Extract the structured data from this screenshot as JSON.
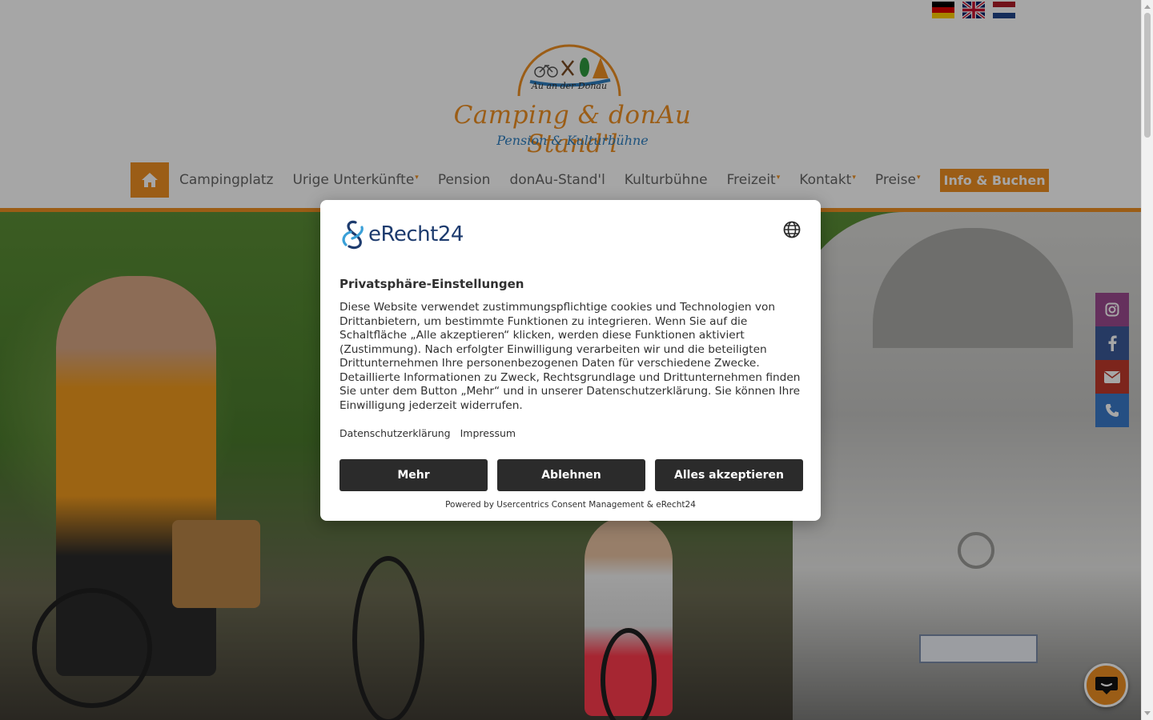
{
  "header": {
    "languages": [
      {
        "name": "de-flag-icon"
      },
      {
        "name": "gb-flag-icon"
      },
      {
        "name": "nl-flag-icon"
      }
    ],
    "logo": {
      "subtitle": "Au an der Donau",
      "title": "Camping & donAu Stand'l",
      "tagline": "Pension & Kulturbühne"
    }
  },
  "nav": {
    "home_icon": "home-icon",
    "items": [
      {
        "label": "Campingplatz",
        "dropdown": false
      },
      {
        "label": "Urige Unterkünfte",
        "dropdown": true
      },
      {
        "label": "Pension",
        "dropdown": false
      },
      {
        "label": "donAu-Stand'l",
        "dropdown": false
      },
      {
        "label": "Kulturbühne",
        "dropdown": false
      },
      {
        "label": "Freizeit",
        "dropdown": true
      },
      {
        "label": "Kontakt",
        "dropdown": true
      },
      {
        "label": "Preise",
        "dropdown": true
      }
    ],
    "cta": "Info & Buchen"
  },
  "social": [
    "instagram-icon",
    "facebook-icon",
    "mail-icon",
    "phone-icon"
  ],
  "consent": {
    "logo_text": "eRecht24",
    "title": "Privatsphäre-Einstellungen",
    "body": "Diese Website verwendet zustimmungspflichtige cookies und Technologien von Drittanbietern, um bestimmte Funktionen zu integrieren. Wenn Sie auf die Schaltfläche „Alle akzeptieren“ klicken, werden diese Funktionen aktiviert (Zustimmung). Nach erfolgter Einwilligung verarbeiten wir und die beteiligten Drittunternehmen Ihre personenbezogenen Daten für verschiedene Zwecke. Detaillierte Informationen zu Zweck, Rechtsgrundlage und Drittunternehmen finden Sie unter dem Button „Mehr“ und in unserer Datenschutzerklärung. Sie können Ihre Einwilligung jederzeit widerrufen.",
    "links": [
      "Datenschutzerklärung",
      "Impressum"
    ],
    "buttons": {
      "more": "Mehr",
      "decline": "Ablehnen",
      "accept": "Alles akzeptieren"
    },
    "powered_by": "Powered by Usercentrics Consent Management & eRecht24"
  },
  "colors": {
    "brand_orange": "#ee8f22",
    "button_dark": "#2b2b2b",
    "tagline_blue": "#2d7fc1"
  }
}
